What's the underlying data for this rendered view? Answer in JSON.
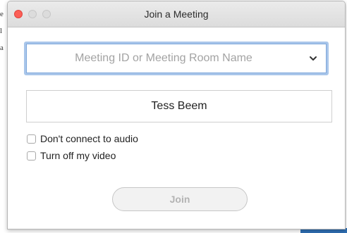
{
  "window": {
    "title": "Join a Meeting"
  },
  "form": {
    "meeting_id_placeholder": "Meeting ID or Meeting Room Name",
    "name_value": "Tess Beem",
    "options": [
      {
        "label": "Don't connect to audio",
        "checked": false
      },
      {
        "label": "Turn off my video",
        "checked": false
      }
    ],
    "join_label": "Join",
    "join_enabled": false
  },
  "background": {
    "letters": [
      "e",
      "l",
      "a"
    ]
  },
  "colors": {
    "close_button": "#fc5f57",
    "focus_ring": "#a9c6ea",
    "taskbar": "#2f6fb3"
  },
  "icons": {
    "dropdown": "chevron-down-icon"
  }
}
